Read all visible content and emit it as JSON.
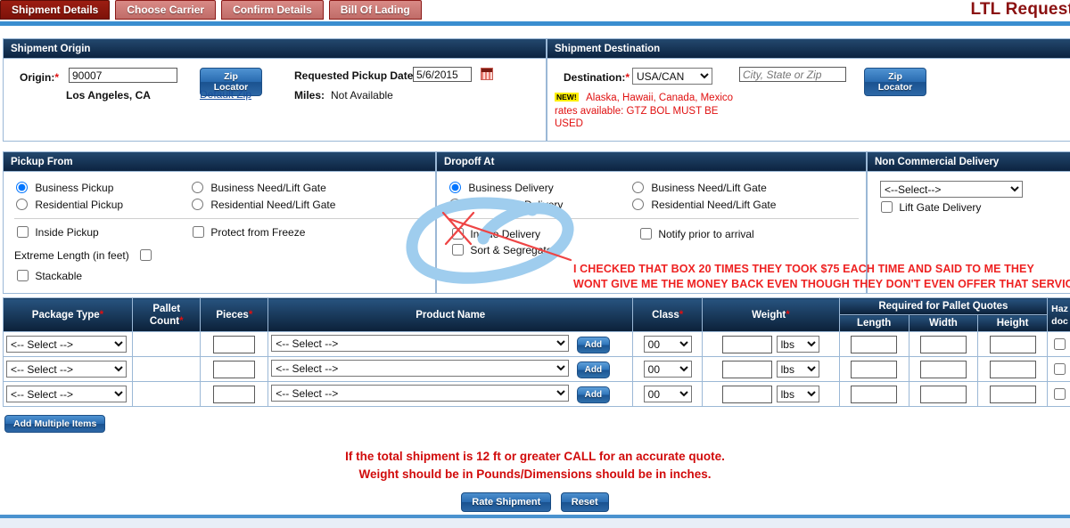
{
  "header": {
    "tabs": [
      {
        "label": "Shipment Details",
        "active": true
      },
      {
        "label": "Choose Carrier",
        "active": false
      },
      {
        "label": "Confirm Details",
        "active": false
      },
      {
        "label": "Bill Of Lading",
        "active": false
      }
    ],
    "page_title": "LTL Request"
  },
  "origin": {
    "section_title": "Shipment Origin",
    "origin_label": "Origin:",
    "origin_value": "90007",
    "zip_locator_label": "Zip Locator",
    "default_zip_label": "Default Zip",
    "resolved_city": "Los Angeles, CA",
    "pickup_date_label": "Requested Pickup Date:",
    "pickup_date_value": "5/6/2015",
    "miles_label": "Miles:",
    "miles_value": "Not Available",
    "calendar_icon": "calendar-icon"
  },
  "destination": {
    "section_title": "Shipment Destination",
    "destination_label": "Destination:",
    "country_selected": "USA/CAN",
    "country_options": [
      "USA/CAN"
    ],
    "city_placeholder": "City, State or Zip",
    "city_value": "",
    "zip_locator_label": "Zip Locator",
    "new_badge": "NEW!",
    "notice_line1": "Alaska, Hawaii, Canada, Mexico",
    "notice_line2": "rates available: GTZ BOL MUST BE",
    "notice_line3": "USED"
  },
  "pickup_from": {
    "section_title": "Pickup From",
    "radio_business": "Business Pickup",
    "radio_residential": "Residential Pickup",
    "radio_business_liftgate": "Business Need/Lift Gate",
    "radio_residential_liftgate": "Residential Need/Lift Gate",
    "chk_inside_pickup": "Inside Pickup",
    "chk_protect_freeze": "Protect from Freeze",
    "lbl_extreme_length": "Extreme Length (in feet)",
    "chk_stackable": "Stackable"
  },
  "dropoff_at": {
    "section_title": "Dropoff At",
    "radio_business": "Business Delivery",
    "radio_residential": "Residential Delivery",
    "radio_business_liftgate": "Business Need/Lift Gate",
    "radio_residential_liftgate": "Residential Need/Lift Gate",
    "chk_inside_delivery": "Inside Delivery",
    "chk_sort_segregate": "Sort & Segregate",
    "chk_notify_prior": "Notify prior to arrival"
  },
  "non_commercial": {
    "section_title": "Non Commercial Delivery",
    "select_value": "<--Select-->",
    "select_options": [
      "<--Select-->"
    ],
    "chk_lift_gate": "Lift Gate Delivery"
  },
  "items_table": {
    "columns": {
      "package_type": "Package Type",
      "pallet_count": "Pallet Count",
      "pieces": "Pieces",
      "product_name": "Product Name",
      "class": "Class",
      "weight": "Weight",
      "pallet_group": "Required for Pallet Quotes",
      "length": "Length",
      "width": "Width",
      "height": "Height",
      "haz": "Haz doc"
    },
    "add_button_label": "Add",
    "rows": [
      {
        "package_type": "<-- Select -->",
        "pallet_count": "",
        "pieces": "",
        "product_name": "<-- Select -->",
        "class": "00",
        "weight": "",
        "weight_unit": "lbs",
        "length": "",
        "width": "",
        "height": "",
        "haz": false
      },
      {
        "package_type": "<-- Select -->",
        "pallet_count": "",
        "pieces": "",
        "product_name": "<-- Select -->",
        "class": "00",
        "weight": "",
        "weight_unit": "lbs",
        "length": "",
        "width": "",
        "height": "",
        "haz": false
      },
      {
        "package_type": "<-- Select -->",
        "pallet_count": "",
        "pieces": "",
        "product_name": "<-- Select -->",
        "class": "00",
        "weight": "",
        "weight_unit": "lbs",
        "length": "",
        "width": "",
        "height": "",
        "haz": false
      }
    ]
  },
  "footer": {
    "add_multiple_label": "Add Multiple Items",
    "callout_line1": "If the total shipment is 12 ft or greater CALL for an accurate quote.",
    "callout_line2": "Weight should be in Pounds/Dimensions should be in inches.",
    "rate_button": "Rate Shipment",
    "reset_button": "Reset"
  },
  "annotation": {
    "text_line1": "I CHECKED THAT BOX 20 TIMES THEY TOOK $75 EACH TIME AND SAID TO ME THEY",
    "text_line2": "WONT GIVE ME THE MONEY BACK EVEN THOUGH THEY DON'T EVEN OFFER THAT SERVICE.",
    "circle_color": "#9fcdee",
    "mark_color": "#ee4444",
    "text_color": "#ee2222"
  }
}
